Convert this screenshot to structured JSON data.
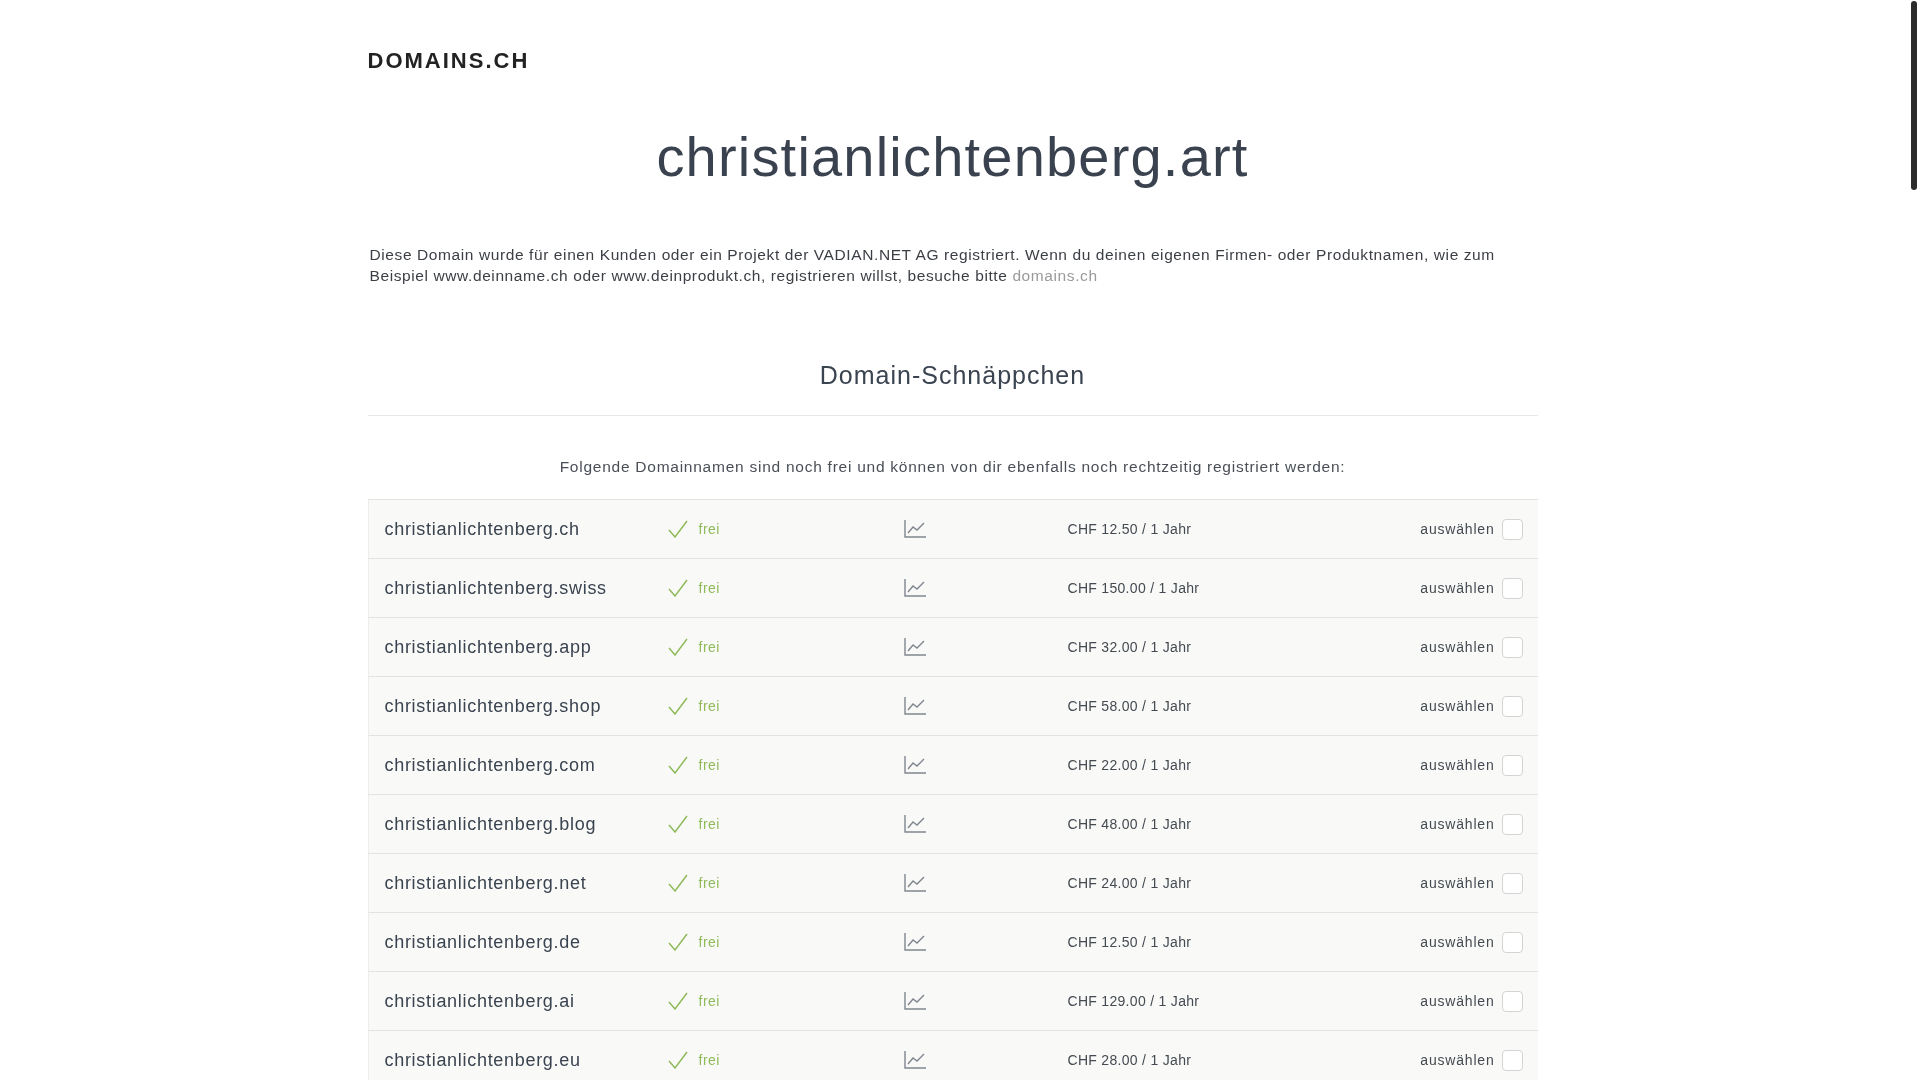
{
  "logo": "DOMAINS.CH",
  "title": "christianlichtenberg.art",
  "intro": {
    "text": "Diese Domain wurde für einen Kunden oder ein Projekt der VADIAN.NET AG registriert. Wenn du deinen eigenen Firmen- oder Produktnamen, wie zum Beispiel www.deinname.ch oder www.deinprodukt.ch, registrieren willst, besuche bitte",
    "link": "domains.ch"
  },
  "offers": {
    "heading": "Domain-Schnäppchen",
    "lead": "Folgende Domainnamen sind noch frei und können von dir ebenfalls noch rechtzeitig registriert werden:",
    "rows": [
      {
        "domain": "christianlichtenberg.ch",
        "available": true,
        "status": "frei",
        "price": "CHF 12.50 / 1 Jahr",
        "select_label": "auswählen",
        "checked": false
      },
      {
        "domain": "christianlichtenberg.swiss",
        "available": true,
        "status": "frei",
        "price": "CHF 150.00 / 1 Jahr",
        "select_label": "auswählen",
        "checked": false
      },
      {
        "domain": "christianlichtenberg.app",
        "available": true,
        "status": "frei",
        "price": "CHF 32.00 / 1 Jahr",
        "select_label": "auswählen",
        "checked": false
      },
      {
        "domain": "christianlichtenberg.shop",
        "available": true,
        "status": "frei",
        "price": "CHF 58.00 / 1 Jahr",
        "select_label": "auswählen",
        "checked": false
      },
      {
        "domain": "christianlichtenberg.com",
        "available": true,
        "status": "frei",
        "price": "CHF 22.00 / 1 Jahr",
        "select_label": "auswählen",
        "checked": false
      },
      {
        "domain": "christianlichtenberg.blog",
        "available": true,
        "status": "frei",
        "price": "CHF 48.00 / 1 Jahr",
        "select_label": "auswählen",
        "checked": false
      },
      {
        "domain": "christianlichtenberg.net",
        "available": true,
        "status": "frei",
        "price": "CHF 24.00 / 1 Jahr",
        "select_label": "auswählen",
        "checked": false
      },
      {
        "domain": "christianlichtenberg.de",
        "available": true,
        "status": "frei",
        "price": "CHF 12.50 / 1 Jahr",
        "select_label": "auswählen",
        "checked": false
      },
      {
        "domain": "christianlichtenberg.ai",
        "available": true,
        "status": "frei",
        "price": "CHF 129.00 / 1 Jahr",
        "select_label": "auswählen",
        "checked": false
      },
      {
        "domain": "christianlichtenberg.eu",
        "available": true,
        "status": "frei",
        "price": "CHF 28.00 / 1 Jahr",
        "select_label": "auswählen",
        "checked": false
      }
    ]
  }
}
